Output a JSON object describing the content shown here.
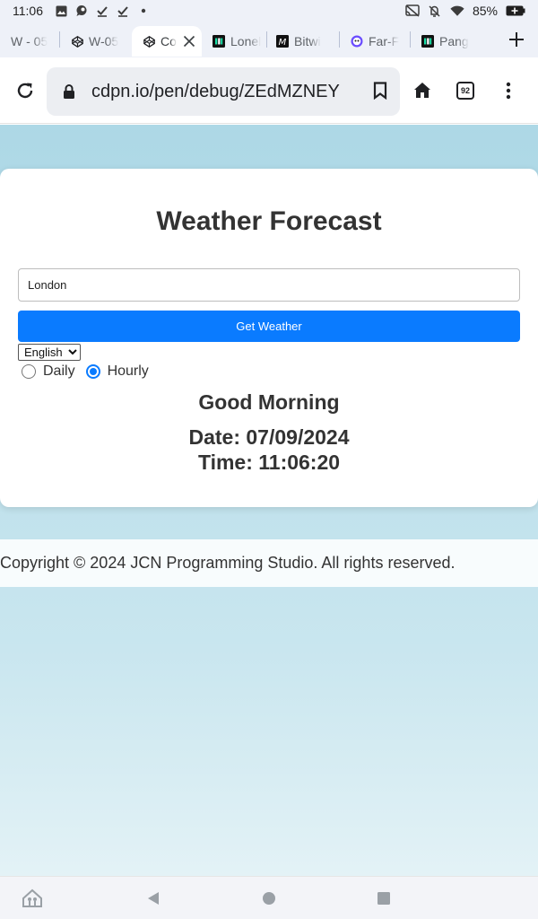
{
  "status_bar": {
    "time": "11:06",
    "battery": "85%",
    "left_icons": [
      "image-icon",
      "chat-icon",
      "check-icon",
      "check-icon",
      "dot-icon"
    ],
    "right_icons": [
      "cast-icon",
      "mute-icon",
      "wifi-icon",
      "battery-icon"
    ]
  },
  "tabs": [
    {
      "label": "W - 05",
      "icon": "codepen-icon",
      "active": false
    },
    {
      "label": "W-05",
      "icon": "codepen-icon",
      "active": false
    },
    {
      "label": "Co",
      "icon": "codepen-icon",
      "active": true
    },
    {
      "label": "Lonel",
      "icon": "notion-icon",
      "active": false
    },
    {
      "label": "Bitwi",
      "icon": "medium-icon",
      "active": false
    },
    {
      "label": "Far-F",
      "icon": "extension-icon",
      "active": false
    },
    {
      "label": "Pang",
      "icon": "notion-icon",
      "active": false
    }
  ],
  "toolbar": {
    "url": "cdpn.io/pen/debug/ZEdMZNEY",
    "tab_count": "92"
  },
  "app": {
    "title": "Weather Forecast",
    "city_value": "London",
    "button_label": "Get Weather",
    "language_selected": "English",
    "radio_daily": "Daily",
    "radio_hourly": "Hourly",
    "selected_mode": "Hourly",
    "greeting": "Good Morning",
    "date_line": "Date: 07/09/2024",
    "time_line": "Time: 11:06:20",
    "footer": "Copyright © 2024 JCN Programming Studio. All rights reserved."
  },
  "colors": {
    "accent": "#0a7bff",
    "page_background": "#add8e6"
  }
}
